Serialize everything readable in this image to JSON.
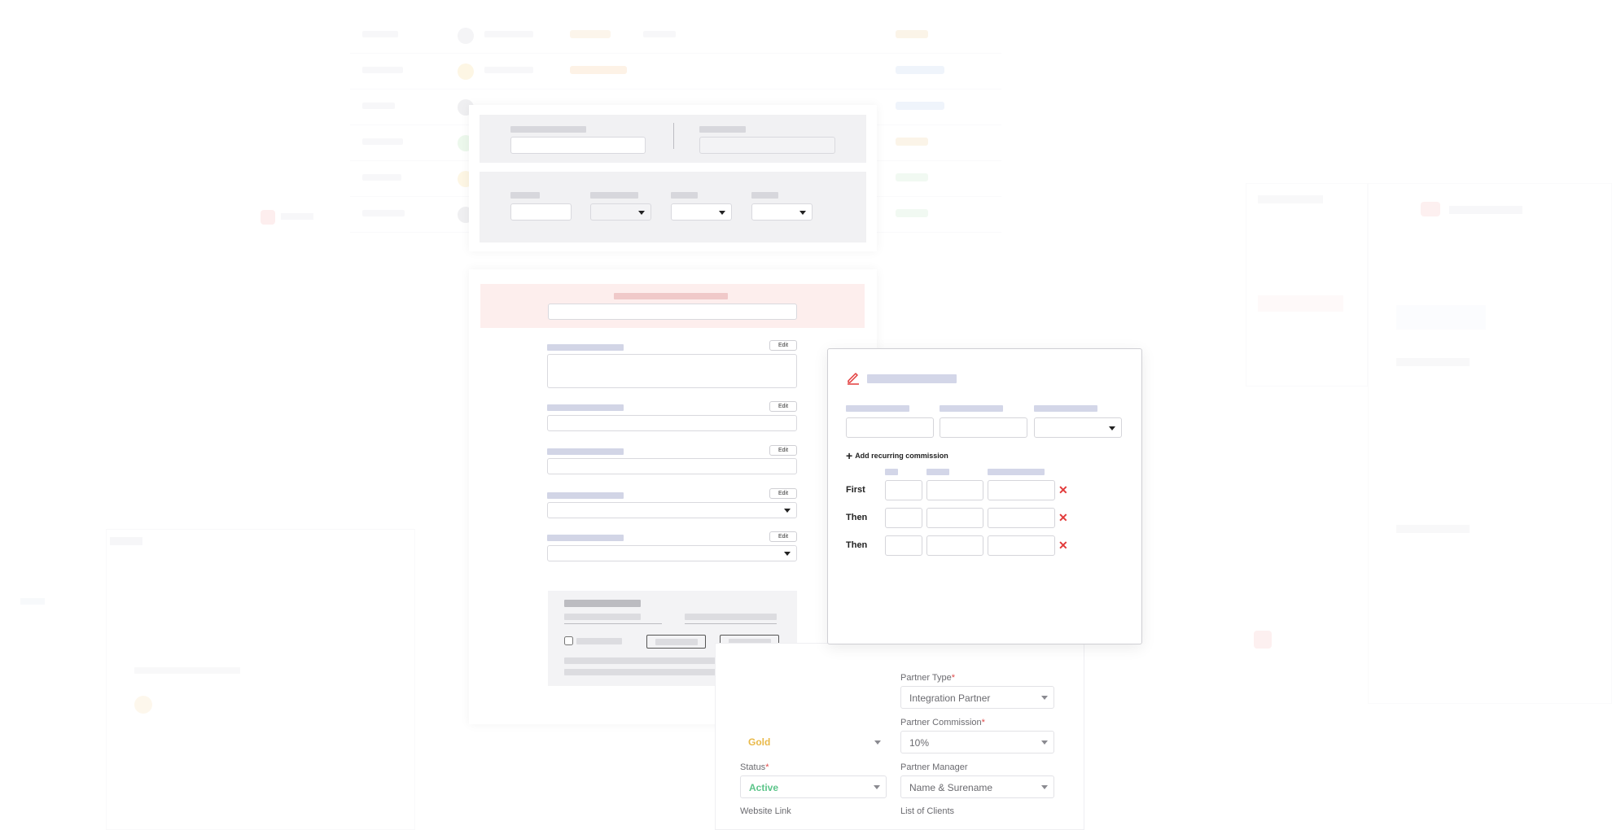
{
  "commission_dialog": {
    "add_recurring_label": "Add recurring commission",
    "rows": [
      {
        "label": "First"
      },
      {
        "label": "Then"
      },
      {
        "label": "Then"
      }
    ]
  },
  "left_panel": {
    "edit_labels": [
      "Edit",
      "Edit",
      "Edit",
      "Edit",
      "Edit"
    ]
  },
  "partner_form": {
    "fields": [
      {
        "label": "Partner Type",
        "required": "*",
        "value": "Integration Partner"
      },
      {
        "label": "",
        "required": "",
        "value": "Gold"
      },
      {
        "label": "Partner Commission",
        "required": "*",
        "value": "10%"
      },
      {
        "label": "Status",
        "required": "*",
        "value": "Active"
      },
      {
        "label": "Partner Manager",
        "required": "",
        "value": "Name & Surename"
      },
      {
        "label": "Website Link",
        "required": "",
        "value": ""
      },
      {
        "label": "List of Clients",
        "required": "",
        "value": ""
      }
    ]
  },
  "colors": {
    "accent_red": "#e23a3a",
    "status_active": "#5cc58a",
    "tier_gold": "#e9b949"
  }
}
